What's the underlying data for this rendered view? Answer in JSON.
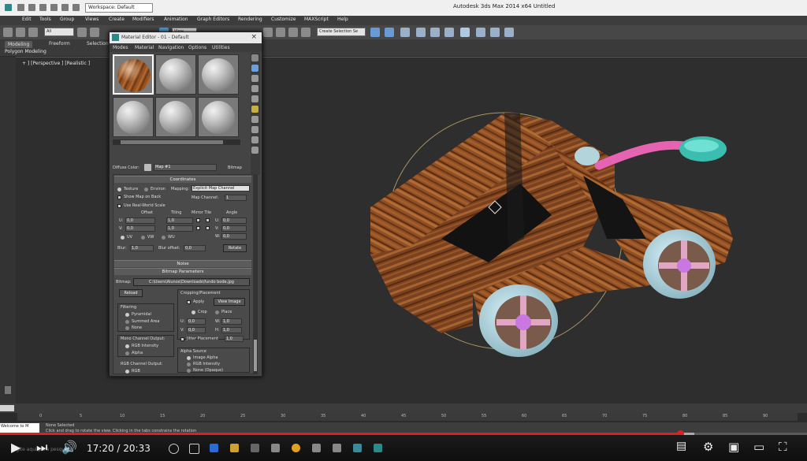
{
  "window": {
    "title": "Autodesk 3ds Max  2014 x64     Untitled",
    "workspace": "Workspace: Default"
  },
  "menu": [
    "Edit",
    "Tools",
    "Group",
    "Views",
    "Create",
    "Modifiers",
    "Animation",
    "Graph Editors",
    "Rendering",
    "Customize",
    "MAXScript",
    "Help"
  ],
  "toolbar": {
    "selection_filter": "All",
    "view_dropdown": "View",
    "selection_set": "Create Selection Se"
  },
  "ribbon": {
    "tabs": [
      "Modeling",
      "Freeform",
      "Selection"
    ],
    "active_tab": "Modeling",
    "sub_label": "Polygon Modeling"
  },
  "viewport": {
    "label": "+ ] [Perspective ] [Realistic ]"
  },
  "material_editor": {
    "title": "Material Editor - 01 - Default",
    "menu": [
      "Modes",
      "Material",
      "Navigation",
      "Options",
      "Utilities"
    ],
    "diffuse_label": "Diffuse Color:",
    "map_name": "Map #1",
    "map_type": "Bitmap",
    "coordinates": {
      "header": "Coordinates",
      "texture_label": "Texture",
      "environ_label": "Environ",
      "mapping_label": "Mapping:",
      "mapping_value": "Explicit Map Channel",
      "show_map_label": "Show Map on Back",
      "map_channel_label": "Map Channel:",
      "map_channel_value": "1",
      "real_world_label": "Use Real-World Scale",
      "col_offset": "Offset",
      "col_tiling": "Tiling",
      "col_mirror_tile": "Mirror Tile",
      "col_angle": "Angle",
      "u_label": "U:",
      "v_label": "V:",
      "w_label": "W:",
      "u_offset": "0,0",
      "v_offset": "0,0",
      "u_tiling": "1,0",
      "v_tiling": "1,0",
      "u_angle": "0,0",
      "v_angle": "0,0",
      "w_angle": "0,0",
      "uv_label": "UV",
      "vw_label": "VW",
      "wu_label": "WU",
      "blur_label": "Blur:",
      "blur_value": "1,0",
      "blur_offset_label": "Blur offset:",
      "blur_offset_value": "0,0",
      "rotate_button": "Rotate"
    },
    "noise_header": "Noise",
    "bitmap_params": {
      "header": "Bitmap Parameters",
      "bitmap_label": "Bitmap:",
      "bitmap_path": "C:\\Users\\Alunos\\Downloads\\fundo bode.jpg",
      "reload_button": "Reload",
      "cropping_label": "Cropping/Placement",
      "apply_label": "Apply",
      "view_image_button": "View Image",
      "crop_label": "Crop",
      "place_label": "Place",
      "u_label": "U:",
      "v_label": "V:",
      "w_label": "W:",
      "h_label": "H:",
      "u_val": "0,0",
      "v_val": "0,0",
      "w_val": "1,0",
      "h_val": "1,0",
      "jitter_label": "Jitter Placement",
      "jitter_val": "1,0",
      "filtering_label": "Filtering",
      "pyramidal": "Pyramidal",
      "summed_area": "Summed Area",
      "none": "None",
      "mono_label": "Mono Channel Output:",
      "rgb_intensity": "RGB Intensity",
      "alpha": "Alpha",
      "alpha_source_label": "Alpha Source",
      "image_alpha": "Image Alpha",
      "rgb_intensity2": "RGB Intensity",
      "none_opaque": "None (Opaque)",
      "rgb_out_label": "RGB Channel Output:",
      "rgb": "RGB"
    }
  },
  "timeline": {
    "ticks": [
      "0",
      "5",
      "10",
      "15",
      "20",
      "25",
      "30",
      "35",
      "40",
      "45",
      "50",
      "55",
      "60",
      "65",
      "70",
      "75",
      "80",
      "85",
      "90"
    ]
  },
  "status": {
    "welcome": "Welcome to M",
    "none_selected": "None Selected",
    "prompt": "Click and drag to rotate the view.  Clicking in the tabs constrains the rotation"
  },
  "video": {
    "current_time": "17:20",
    "duration": "20:33",
    "time_display": "17:20 / 20:33",
    "progress": 0.843,
    "buffered": 0.86,
    "colors": {
      "played": "#e01f1f",
      "buffer": "#aaaaaa"
    }
  },
  "taskbar": {
    "search_placeholder": "Digite aqui para pesquisar"
  }
}
